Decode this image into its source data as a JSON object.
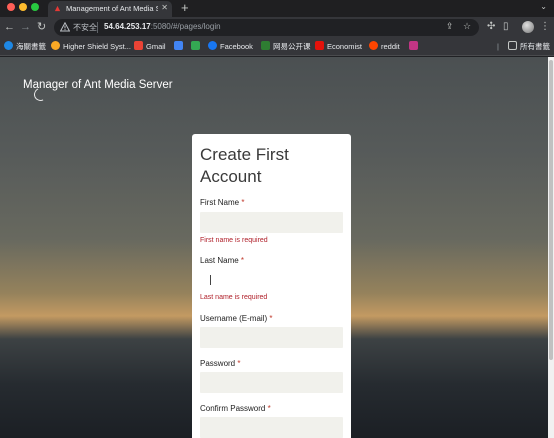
{
  "browser": {
    "tab_title": "Management of Ant Media Se",
    "new_tab": "+",
    "security_label": "不安全",
    "url_host": "54.64.253.17",
    "url_rest": ":5080/#/pages/login",
    "bookmarks": [
      "海關書籤",
      "Higher Shield Syst...",
      "Gmail",
      "Facebook",
      "网易公开课",
      "Economist",
      "reddit",
      "所有書籤"
    ]
  },
  "page": {
    "brand": "Manager of Ant Media Server",
    "card_title": "Create First Account",
    "first_name_label": "First Name",
    "first_name_error": "First name is required",
    "last_name_label": "Last Name",
    "last_name_error": "Last name is required",
    "username_label": "Username (E-mail)",
    "password_label": "Password",
    "confirm_label": "Confirm Password",
    "required_mark": "*"
  },
  "colors": {
    "error": "#b0202a",
    "input_bg": "#f1f1ec",
    "chrome_bg": "#35363a"
  }
}
